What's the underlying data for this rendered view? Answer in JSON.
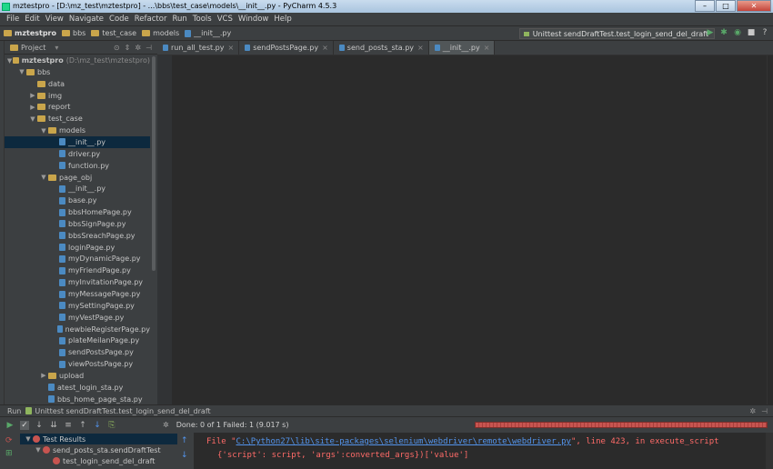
{
  "window": {
    "title": "mztestpro - [D:\\mz_test\\mztestpro] - ...\\bbs\\test_case\\models\\__init__.py - PyCharm 4.5.3",
    "controls": [
      "–",
      "□",
      "✕"
    ]
  },
  "menu": [
    "File",
    "Edit",
    "View",
    "Navigate",
    "Code",
    "Refactor",
    "Run",
    "Tools",
    "VCS",
    "Window",
    "Help"
  ],
  "breadcrumbs": [
    "mztestpro",
    "bbs",
    "test_case",
    "models",
    "__init__.py"
  ],
  "run_config": "Unittest sendDraftTest.test_login_send_del_draft",
  "project_panel": {
    "title": "Project"
  },
  "tree": [
    {
      "label": "mztestpro",
      "extra": "(D:\\mz_test\\mztestpro)",
      "type": "folder",
      "depth": 0,
      "arrow": "▼",
      "bold": true
    },
    {
      "label": "bbs",
      "type": "folder",
      "depth": 1,
      "arrow": "▼"
    },
    {
      "label": "data",
      "type": "folder",
      "depth": 2,
      "arrow": ""
    },
    {
      "label": "img",
      "type": "folder",
      "depth": 2,
      "arrow": "▶"
    },
    {
      "label": "report",
      "type": "folder",
      "depth": 2,
      "arrow": "▶"
    },
    {
      "label": "test_case",
      "type": "folder",
      "depth": 2,
      "arrow": "▼"
    },
    {
      "label": "models",
      "type": "folder",
      "depth": 3,
      "arrow": "▼"
    },
    {
      "label": "__init__.py",
      "type": "file",
      "depth": 4,
      "arrow": "",
      "selected": true
    },
    {
      "label": "driver.py",
      "type": "file",
      "depth": 4,
      "arrow": ""
    },
    {
      "label": "function.py",
      "type": "file",
      "depth": 4,
      "arrow": ""
    },
    {
      "label": "page_obj",
      "type": "folder",
      "depth": 3,
      "arrow": "▼"
    },
    {
      "label": "__init__.py",
      "type": "file",
      "depth": 4,
      "arrow": ""
    },
    {
      "label": "base.py",
      "type": "file",
      "depth": 4,
      "arrow": ""
    },
    {
      "label": "bbsHomePage.py",
      "type": "file",
      "depth": 4,
      "arrow": ""
    },
    {
      "label": "bbsSignPage.py",
      "type": "file",
      "depth": 4,
      "arrow": ""
    },
    {
      "label": "bbsSreachPage.py",
      "type": "file",
      "depth": 4,
      "arrow": ""
    },
    {
      "label": "loginPage.py",
      "type": "file",
      "depth": 4,
      "arrow": ""
    },
    {
      "label": "myDynamicPage.py",
      "type": "file",
      "depth": 4,
      "arrow": ""
    },
    {
      "label": "myFriendPage.py",
      "type": "file",
      "depth": 4,
      "arrow": ""
    },
    {
      "label": "myInvitationPage.py",
      "type": "file",
      "depth": 4,
      "arrow": ""
    },
    {
      "label": "myMessagePage.py",
      "type": "file",
      "depth": 4,
      "arrow": ""
    },
    {
      "label": "mySettingPage.py",
      "type": "file",
      "depth": 4,
      "arrow": ""
    },
    {
      "label": "myVestPage.py",
      "type": "file",
      "depth": 4,
      "arrow": ""
    },
    {
      "label": "newbieRegisterPage.py",
      "type": "file",
      "depth": 4,
      "arrow": ""
    },
    {
      "label": "plateMeilanPage.py",
      "type": "file",
      "depth": 4,
      "arrow": ""
    },
    {
      "label": "sendPostsPage.py",
      "type": "file",
      "depth": 4,
      "arrow": ""
    },
    {
      "label": "viewPostsPage.py",
      "type": "file",
      "depth": 4,
      "arrow": ""
    },
    {
      "label": "upload",
      "type": "folder",
      "depth": 3,
      "arrow": "▶"
    },
    {
      "label": "atest_login_sta.py",
      "type": "file",
      "depth": 3,
      "arrow": ""
    },
    {
      "label": "bbs_home_page_sta.py",
      "type": "file",
      "depth": 3,
      "arrow": ""
    }
  ],
  "tabs": [
    {
      "label": "run_all_test.py",
      "active": false
    },
    {
      "label": "sendPostsPage.py",
      "active": false
    },
    {
      "label": "send_posts_sta.py",
      "active": false
    },
    {
      "label": "__init__.py",
      "active": true
    }
  ],
  "run_panel": {
    "label": "Run",
    "config": "Unittest sendDraftTest.test_login_send_del_draft",
    "status": "Done: 0 of 1   Failed: 1   (9.017 s)"
  },
  "results": [
    {
      "label": "Test Results",
      "depth": 0
    },
    {
      "label": "send_posts_sta.sendDraftTest",
      "depth": 1
    },
    {
      "label": "test_login_send_del_draft",
      "depth": 2
    }
  ],
  "console": {
    "line1_prefix": "File \"",
    "line1_path": "C:\\Python27\\lib\\site-packages\\selenium\\webdriver\\remote\\webdriver.py",
    "line1_suffix": "\", line 423, in execute_script",
    "line2": "{'script': script, 'args':converted_args})['value']"
  },
  "colors": {
    "selection": "#0d293e",
    "error": "#c75450",
    "link": "#5394ec",
    "folder": "#c9a54b"
  }
}
